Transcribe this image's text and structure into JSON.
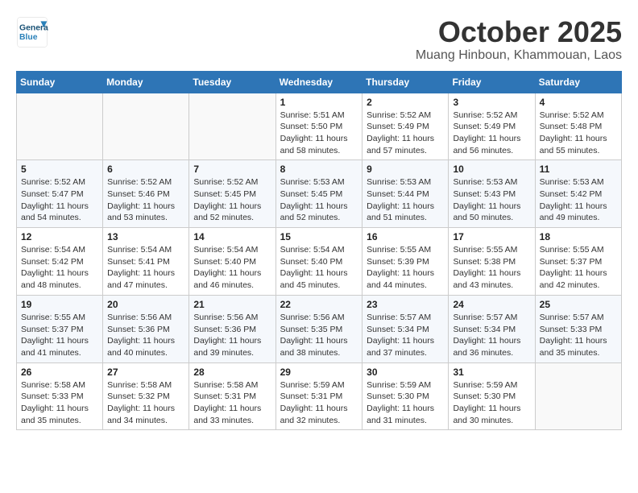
{
  "header": {
    "logo_line1": "General",
    "logo_line2": "Blue",
    "month": "October 2025",
    "location": "Muang Hinboun, Khammouan, Laos"
  },
  "weekdays": [
    "Sunday",
    "Monday",
    "Tuesday",
    "Wednesday",
    "Thursday",
    "Friday",
    "Saturday"
  ],
  "weeks": [
    [
      {
        "day": "",
        "info": ""
      },
      {
        "day": "",
        "info": ""
      },
      {
        "day": "",
        "info": ""
      },
      {
        "day": "1",
        "info": "Sunrise: 5:51 AM\nSunset: 5:50 PM\nDaylight: 11 hours\nand 58 minutes."
      },
      {
        "day": "2",
        "info": "Sunrise: 5:52 AM\nSunset: 5:49 PM\nDaylight: 11 hours\nand 57 minutes."
      },
      {
        "day": "3",
        "info": "Sunrise: 5:52 AM\nSunset: 5:49 PM\nDaylight: 11 hours\nand 56 minutes."
      },
      {
        "day": "4",
        "info": "Sunrise: 5:52 AM\nSunset: 5:48 PM\nDaylight: 11 hours\nand 55 minutes."
      }
    ],
    [
      {
        "day": "5",
        "info": "Sunrise: 5:52 AM\nSunset: 5:47 PM\nDaylight: 11 hours\nand 54 minutes."
      },
      {
        "day": "6",
        "info": "Sunrise: 5:52 AM\nSunset: 5:46 PM\nDaylight: 11 hours\nand 53 minutes."
      },
      {
        "day": "7",
        "info": "Sunrise: 5:52 AM\nSunset: 5:45 PM\nDaylight: 11 hours\nand 52 minutes."
      },
      {
        "day": "8",
        "info": "Sunrise: 5:53 AM\nSunset: 5:45 PM\nDaylight: 11 hours\nand 52 minutes."
      },
      {
        "day": "9",
        "info": "Sunrise: 5:53 AM\nSunset: 5:44 PM\nDaylight: 11 hours\nand 51 minutes."
      },
      {
        "day": "10",
        "info": "Sunrise: 5:53 AM\nSunset: 5:43 PM\nDaylight: 11 hours\nand 50 minutes."
      },
      {
        "day": "11",
        "info": "Sunrise: 5:53 AM\nSunset: 5:42 PM\nDaylight: 11 hours\nand 49 minutes."
      }
    ],
    [
      {
        "day": "12",
        "info": "Sunrise: 5:54 AM\nSunset: 5:42 PM\nDaylight: 11 hours\nand 48 minutes."
      },
      {
        "day": "13",
        "info": "Sunrise: 5:54 AM\nSunset: 5:41 PM\nDaylight: 11 hours\nand 47 minutes."
      },
      {
        "day": "14",
        "info": "Sunrise: 5:54 AM\nSunset: 5:40 PM\nDaylight: 11 hours\nand 46 minutes."
      },
      {
        "day": "15",
        "info": "Sunrise: 5:54 AM\nSunset: 5:40 PM\nDaylight: 11 hours\nand 45 minutes."
      },
      {
        "day": "16",
        "info": "Sunrise: 5:55 AM\nSunset: 5:39 PM\nDaylight: 11 hours\nand 44 minutes."
      },
      {
        "day": "17",
        "info": "Sunrise: 5:55 AM\nSunset: 5:38 PM\nDaylight: 11 hours\nand 43 minutes."
      },
      {
        "day": "18",
        "info": "Sunrise: 5:55 AM\nSunset: 5:37 PM\nDaylight: 11 hours\nand 42 minutes."
      }
    ],
    [
      {
        "day": "19",
        "info": "Sunrise: 5:55 AM\nSunset: 5:37 PM\nDaylight: 11 hours\nand 41 minutes."
      },
      {
        "day": "20",
        "info": "Sunrise: 5:56 AM\nSunset: 5:36 PM\nDaylight: 11 hours\nand 40 minutes."
      },
      {
        "day": "21",
        "info": "Sunrise: 5:56 AM\nSunset: 5:36 PM\nDaylight: 11 hours\nand 39 minutes."
      },
      {
        "day": "22",
        "info": "Sunrise: 5:56 AM\nSunset: 5:35 PM\nDaylight: 11 hours\nand 38 minutes."
      },
      {
        "day": "23",
        "info": "Sunrise: 5:57 AM\nSunset: 5:34 PM\nDaylight: 11 hours\nand 37 minutes."
      },
      {
        "day": "24",
        "info": "Sunrise: 5:57 AM\nSunset: 5:34 PM\nDaylight: 11 hours\nand 36 minutes."
      },
      {
        "day": "25",
        "info": "Sunrise: 5:57 AM\nSunset: 5:33 PM\nDaylight: 11 hours\nand 35 minutes."
      }
    ],
    [
      {
        "day": "26",
        "info": "Sunrise: 5:58 AM\nSunset: 5:33 PM\nDaylight: 11 hours\nand 35 minutes."
      },
      {
        "day": "27",
        "info": "Sunrise: 5:58 AM\nSunset: 5:32 PM\nDaylight: 11 hours\nand 34 minutes."
      },
      {
        "day": "28",
        "info": "Sunrise: 5:58 AM\nSunset: 5:31 PM\nDaylight: 11 hours\nand 33 minutes."
      },
      {
        "day": "29",
        "info": "Sunrise: 5:59 AM\nSunset: 5:31 PM\nDaylight: 11 hours\nand 32 minutes."
      },
      {
        "day": "30",
        "info": "Sunrise: 5:59 AM\nSunset: 5:30 PM\nDaylight: 11 hours\nand 31 minutes."
      },
      {
        "day": "31",
        "info": "Sunrise: 5:59 AM\nSunset: 5:30 PM\nDaylight: 11 hours\nand 30 minutes."
      },
      {
        "day": "",
        "info": ""
      }
    ]
  ]
}
